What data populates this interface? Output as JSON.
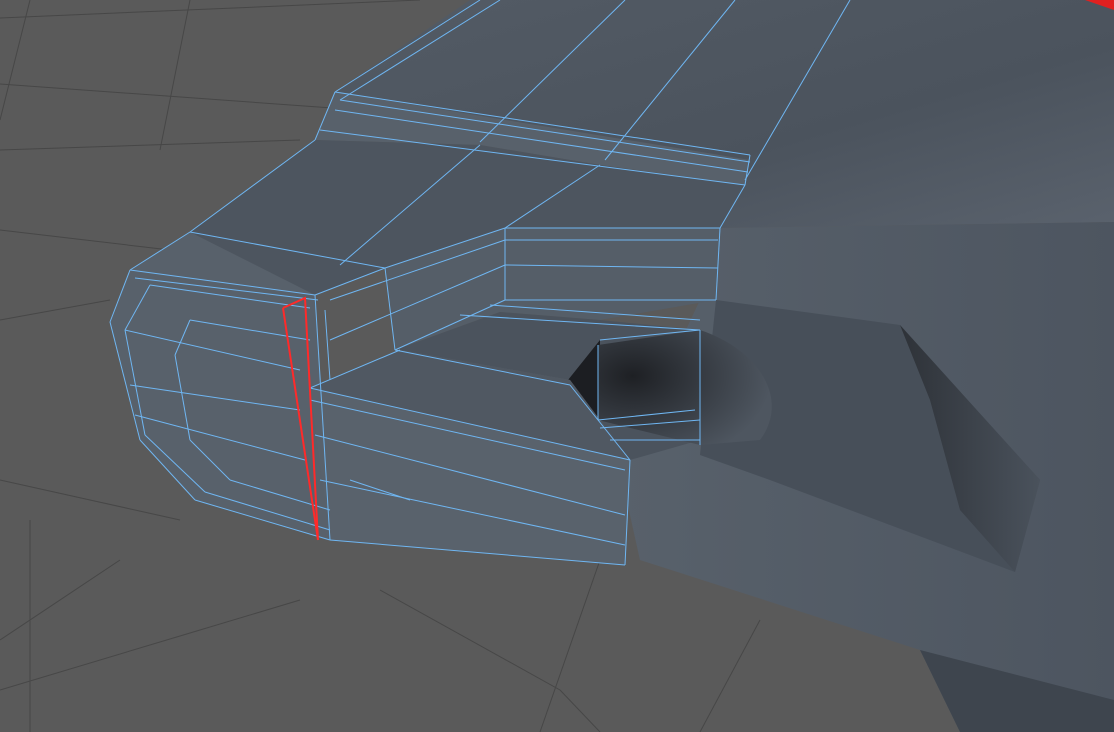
{
  "viewport": {
    "mode": "perspective",
    "background_color": "#5a5a5a",
    "grid_color": "#474747",
    "mesh_color": "#4f5761",
    "wireframe_color": "#6fb6f2",
    "selected_edge_color": "#ff2a2a",
    "axis_gizmo_color": "#e02020"
  },
  "selection": {
    "type": "edge-loop",
    "count": 1
  },
  "icons": [
    "axis-arrow-icon"
  ]
}
